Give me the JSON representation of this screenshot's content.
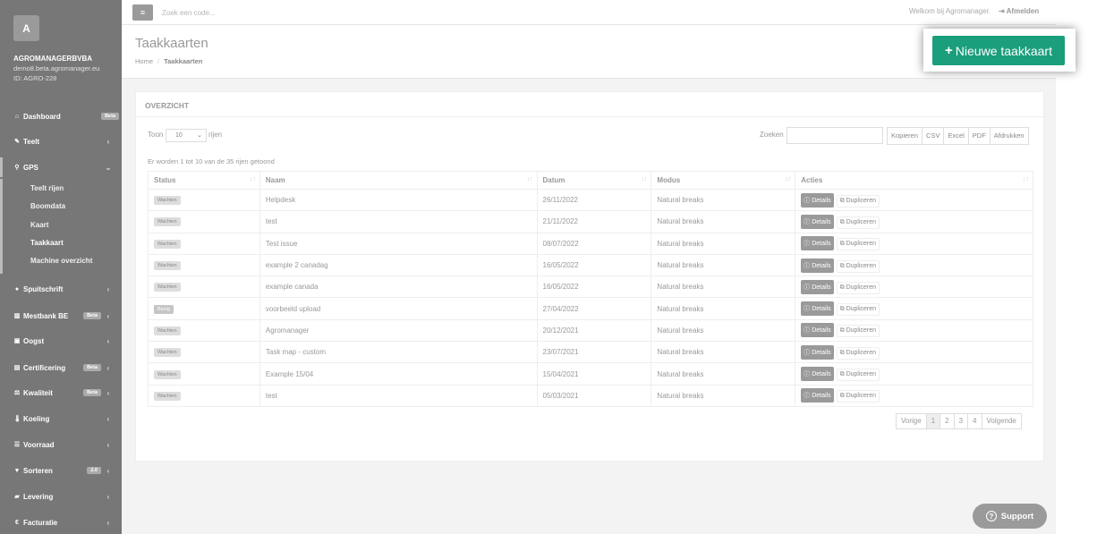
{
  "sidebar": {
    "avatar_letter": "A",
    "company": "AGROMANAGERBVBA",
    "domain": "demo8.beta.agromanager.eu",
    "id_label": "ID: AGRO-228",
    "nav": [
      {
        "label": "Dashboard",
        "icon": "home-icon",
        "glyph": "⌂",
        "badge": "Beta",
        "chevron": ""
      },
      {
        "label": "Teelt",
        "icon": "leaf-icon",
        "glyph": "✎",
        "badge": "",
        "chevron": "‹"
      },
      {
        "label": "GPS",
        "icon": "map-marker-icon",
        "glyph": "⚲",
        "badge": "",
        "chevron": "⌄"
      },
      {
        "label": "Spuitschrift",
        "icon": "drop-icon",
        "glyph": "●",
        "badge": "",
        "chevron": "‹"
      },
      {
        "label": "Mestbank BE",
        "icon": "bank-icon",
        "glyph": "▥",
        "badge": "Beta",
        "chevron": "‹"
      },
      {
        "label": "Oogst",
        "icon": "basket-icon",
        "glyph": "▣",
        "badge": "",
        "chevron": "‹"
      },
      {
        "label": "Certificering",
        "icon": "book-icon",
        "glyph": "▤",
        "badge": "Beta",
        "chevron": "‹"
      },
      {
        "label": "Kwaliteit",
        "icon": "balance-icon",
        "glyph": "⚖",
        "badge": "Beta",
        "chevron": "‹"
      },
      {
        "label": "Koeling",
        "icon": "thermometer-icon",
        "glyph": "🌡",
        "badge": "",
        "chevron": "‹"
      },
      {
        "label": "Voorraad",
        "icon": "list-icon",
        "glyph": "☰",
        "badge": "",
        "chevron": "‹"
      },
      {
        "label": "Sorteren",
        "icon": "filter-icon",
        "glyph": "▼",
        "badge": "2.0",
        "chevron": "‹"
      },
      {
        "label": "Levering",
        "icon": "truck-icon",
        "glyph": "▰",
        "badge": "",
        "chevron": "‹"
      },
      {
        "label": "Facturatie",
        "icon": "euro-icon",
        "glyph": "€",
        "badge": "",
        "chevron": "‹"
      }
    ],
    "gps_sub": [
      "Teelt rijen",
      "Boomdata",
      "Kaart",
      "Taakkaart",
      "Machine overzicht"
    ]
  },
  "topbar": {
    "menu_glyph": "≡",
    "search_placeholder": "Zoek een code...",
    "welcome": "Welkom bij Agromanager.",
    "logout": "Afmelden"
  },
  "header": {
    "title": "Taakkaarten",
    "breadcrumb_home": "Home",
    "breadcrumb_sep": "/",
    "breadcrumb_current": "Taakkaarten",
    "new_button": "Nieuwe taakkaart"
  },
  "panel": {
    "title": "OVERZICHT",
    "length_prefix": "Toon",
    "length_value": "10",
    "length_suffix": "rijen",
    "search_label": "Zoeken",
    "export_buttons": [
      "Kopieren",
      "CSV",
      "Excel",
      "PDF",
      "Afdrukken"
    ],
    "info": "Er worden 1 tot 10 van de 35 rijen getoond",
    "columns": [
      "Status",
      "Naam",
      "Datum",
      "Modus",
      "Acties"
    ],
    "details_label": "Details",
    "duplicate_label": "Dupliceren",
    "rows": [
      {
        "status": "Wachten",
        "naam": "Helpdesk",
        "datum": "26/11/2022",
        "modus": "Natural breaks"
      },
      {
        "status": "Wachten",
        "naam": "test",
        "datum": "21/11/2022",
        "modus": "Natural breaks"
      },
      {
        "status": "Wachten",
        "naam": "Test issue",
        "datum": "08/07/2022",
        "modus": "Natural breaks"
      },
      {
        "status": "Wachten",
        "naam": "example 2 canadag",
        "datum": "16/05/2022",
        "modus": "Natural breaks"
      },
      {
        "status": "Wachten",
        "naam": "example canada",
        "datum": "16/05/2022",
        "modus": "Natural breaks"
      },
      {
        "status": "Bezig",
        "naam": "voorbeeld upload",
        "datum": "27/04/2022",
        "modus": "Natural breaks"
      },
      {
        "status": "Wachten",
        "naam": "Agromanager",
        "datum": "20/12/2021",
        "modus": "Natural breaks"
      },
      {
        "status": "Wachten",
        "naam": "Task map - custom",
        "datum": "23/07/2021",
        "modus": "Natural breaks"
      },
      {
        "status": "Wachten",
        "naam": "Example 15/04",
        "datum": "15/04/2021",
        "modus": "Natural breaks"
      },
      {
        "status": "Wachten",
        "naam": "test",
        "datum": "05/03/2021",
        "modus": "Natural breaks"
      }
    ],
    "pagination": [
      "Vorige",
      "1",
      "2",
      "3",
      "4",
      "Volgende"
    ],
    "current_page": "1"
  },
  "support_label": "Support",
  "colors": {
    "sidebar": "#777777",
    "cta": "#1a9e7b",
    "background": "#f3f3f3"
  }
}
